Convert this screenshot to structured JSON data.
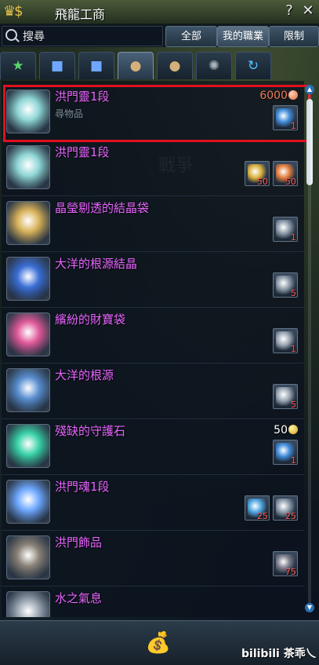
{
  "window": {
    "title": "飛龍工商",
    "help_label": "?",
    "close_label": "✕"
  },
  "search": {
    "placeholder": "搜尋",
    "filters": [
      {
        "label": "全部",
        "active": false
      },
      {
        "label": "我的職業",
        "active": true
      },
      {
        "label": "限制",
        "active": false
      }
    ]
  },
  "tabs": [
    {
      "icon": "star-icon",
      "glyph": "★"
    },
    {
      "icon": "gift-icon",
      "glyph": "🎁"
    },
    {
      "icon": "gift-icon",
      "glyph": "🎁"
    },
    {
      "icon": "sack-icon",
      "glyph": "👜",
      "active": true
    },
    {
      "icon": "sack-icon",
      "glyph": "👜"
    },
    {
      "icon": "orb-icon",
      "glyph": "✺"
    },
    {
      "icon": "refresh-icon",
      "glyph": "↻"
    }
  ],
  "items": [
    {
      "name": "洪門靈1段",
      "sub": "尋物品",
      "price": "6000",
      "currency": "red",
      "materials": [
        {
          "count": "1",
          "color": "#3d8ad8"
        }
      ],
      "thumb_color": "#8fd5d5"
    },
    {
      "name": "洪門靈1段",
      "sub": "",
      "price": "",
      "materials": [
        {
          "count": "50",
          "color": "#d9b13a"
        },
        {
          "count": "50",
          "color": "#e07a3a"
        }
      ],
      "thumb_color": "#8fd5d5"
    },
    {
      "name": "晶瑩剔透的結晶袋",
      "sub": "",
      "price": "",
      "materials": [
        {
          "count": "1",
          "color": "#8a98a8"
        }
      ],
      "thumb_color": "#d8b25a"
    },
    {
      "name": "大洋的根源結晶",
      "sub": "",
      "price": "",
      "materials": [
        {
          "count": "5",
          "color": "#8a98a8"
        }
      ],
      "thumb_color": "#3b6fd6"
    },
    {
      "name": "繽紛的財寶袋",
      "sub": "",
      "price": "",
      "materials": [
        {
          "count": "1",
          "color": "#9aa6b3"
        }
      ],
      "thumb_color": "#e05a9a"
    },
    {
      "name": "大洋的根源",
      "sub": "",
      "price": "",
      "materials": [
        {
          "count": "5",
          "color": "#9aa6b3"
        }
      ],
      "thumb_color": "#5a8fd0"
    },
    {
      "name": "殘缺的守護石",
      "sub": "",
      "price": "50",
      "currency": "gold",
      "materials": [
        {
          "count": "1",
          "color": "#3d8ad8"
        }
      ],
      "thumb_color": "#3ad2a8"
    },
    {
      "name": "洪門魂1段",
      "sub": "",
      "price": "",
      "materials": [
        {
          "count": "25",
          "color": "#4aa3e0"
        },
        {
          "count": "25",
          "color": "#8a98a8"
        }
      ],
      "thumb_color": "#6fa8ff"
    },
    {
      "name": "洪門飾品",
      "sub": "",
      "price": "",
      "materials": [
        {
          "count": "75",
          "color": "#7a7a8a"
        }
      ],
      "thumb_color": "#8a8278"
    },
    {
      "name": "水之氣息",
      "sub": "",
      "price": "",
      "materials": [],
      "thumb_color": "#9aa6b3"
    }
  ],
  "watermark": "戰爭",
  "footer": {
    "mark": "bilibili 茶乖乀"
  }
}
